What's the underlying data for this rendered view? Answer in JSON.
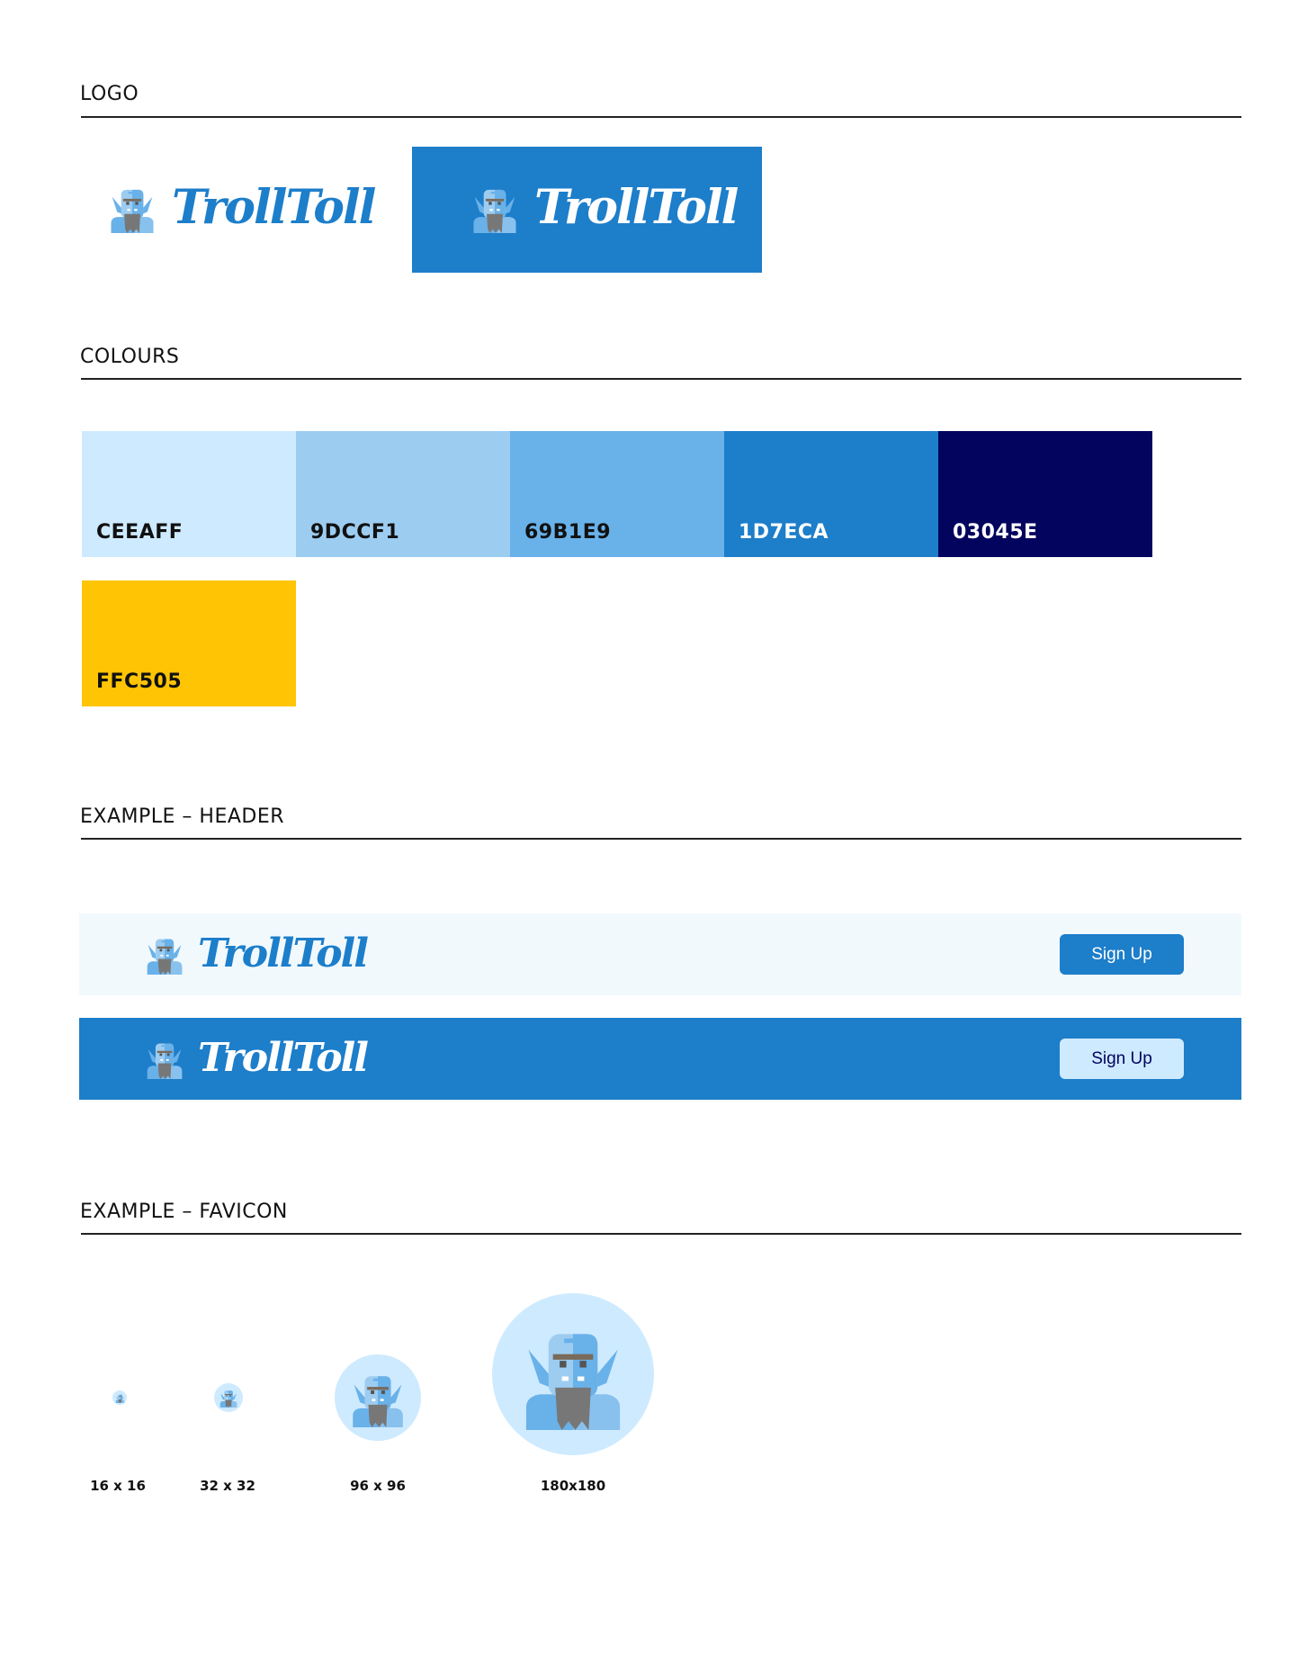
{
  "sections": {
    "logo": "LOGO",
    "colours": "COLOURS",
    "header_example": "EXAMPLE – HEADER",
    "favicon_example": "EXAMPLE – FAVICON"
  },
  "brand": {
    "wordmark": "TrollToll",
    "logo_icon": "troll-icon"
  },
  "colours": [
    {
      "hex": "CEEAFF",
      "color": "#CEEAFF",
      "text_color": "#111111"
    },
    {
      "hex": "9DCCF1",
      "color": "#9DCCF1",
      "text_color": "#111111"
    },
    {
      "hex": "69B1E9",
      "color": "#69B1E9",
      "text_color": "#111111"
    },
    {
      "hex": "1D7ECA",
      "color": "#1D7ECA",
      "text_color": "#ffffff"
    },
    {
      "hex": "03045E",
      "color": "#03045E",
      "text_color": "#ffffff"
    },
    {
      "hex": "FFC505",
      "color": "#FFC505",
      "text_color": "#111111"
    }
  ],
  "headers": {
    "light": {
      "background": "#F1F9FD",
      "signup_label": "Sign Up"
    },
    "blue": {
      "background": "#1D7ECA",
      "signup_label": "Sign Up"
    }
  },
  "favicons": [
    {
      "label": "16 x 16"
    },
    {
      "label": "32 x 32"
    },
    {
      "label": "96 x 96"
    },
    {
      "label": "180x180"
    }
  ]
}
